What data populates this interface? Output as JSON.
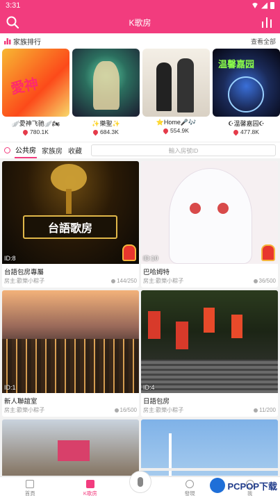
{
  "status": {
    "time": "3:31"
  },
  "header": {
    "title": "K歌房"
  },
  "family": {
    "section_title": "家族排行",
    "more": "查看全部",
    "items": [
      {
        "name": "🪽愛神飞驰🪽🏍",
        "score": "780.1K"
      },
      {
        "name": "✨樂聖✨",
        "score": "684.3K"
      },
      {
        "name": "⭐Home🎤🎶",
        "score": "554.9K"
      },
      {
        "name": "☪温馨嘉园☪",
        "score": "477.8K"
      }
    ]
  },
  "tabs": {
    "items": [
      "公共房",
      "家族房",
      "收藏"
    ],
    "active_index": 0,
    "room_placeholder": "輸入房號ID"
  },
  "rooms": [
    {
      "id": "ID:8",
      "title": "台語包房專屬",
      "owner": "房主:歡樂小粽子",
      "count": "144/250",
      "banner": "台語歌房"
    },
    {
      "id": "ID:10",
      "title": "巴哈姆特",
      "owner": "房主:歡樂小粽子",
      "count": "36/500"
    },
    {
      "id": "ID:1",
      "title": "新人聯誼室",
      "owner": "房主:歡樂小粽子",
      "count": "16/500"
    },
    {
      "id": "ID:4",
      "title": "日語包房",
      "owner": "房主:歡樂小粽子",
      "count": "11/200"
    }
  ],
  "nav": {
    "items": [
      "首頁",
      "K歌房",
      "發現",
      "我"
    ],
    "active_index": 1
  },
  "watermark": {
    "text": "PCPOP下载"
  },
  "colors": {
    "accent": "#f23c7e"
  }
}
